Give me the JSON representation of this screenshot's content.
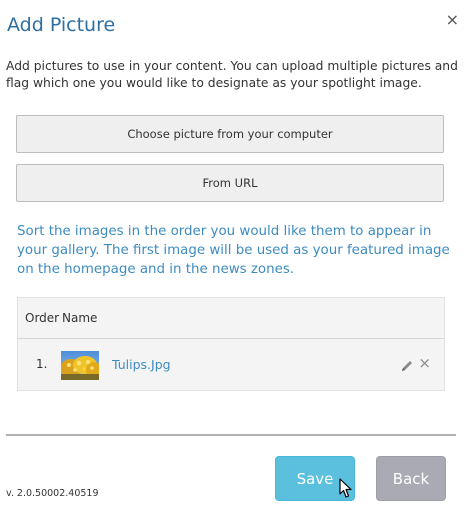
{
  "dialog": {
    "title": "Add Picture",
    "close_label": "×"
  },
  "intro": {
    "text": "Add pictures to use in your content. You can upload multiple pictures and flag which one you would like to designate as your spotlight image."
  },
  "buttons": {
    "choose_label": "Choose picture from your computer",
    "url_label": "From URL"
  },
  "sort_note": {
    "text": "Sort the images in the order you would like them to appear in your gallery. The first image will be used as your featured image on the homepage and in the news zones."
  },
  "table": {
    "headers": {
      "order": "Order",
      "name": "Name"
    },
    "rows": [
      {
        "order": "1.",
        "name": "Tulips.Jpg"
      }
    ]
  },
  "footer": {
    "version": "v. 2.0.50002.40519",
    "save_label": "Save",
    "back_label": "Back"
  },
  "colors": {
    "title": "#2e6fa3",
    "link": "#3d8cc0",
    "save": "#5bc0de",
    "back": "#a9aab3"
  },
  "icons": {
    "close": "close-icon",
    "edit": "pencil-icon",
    "remove": "remove-icon"
  }
}
